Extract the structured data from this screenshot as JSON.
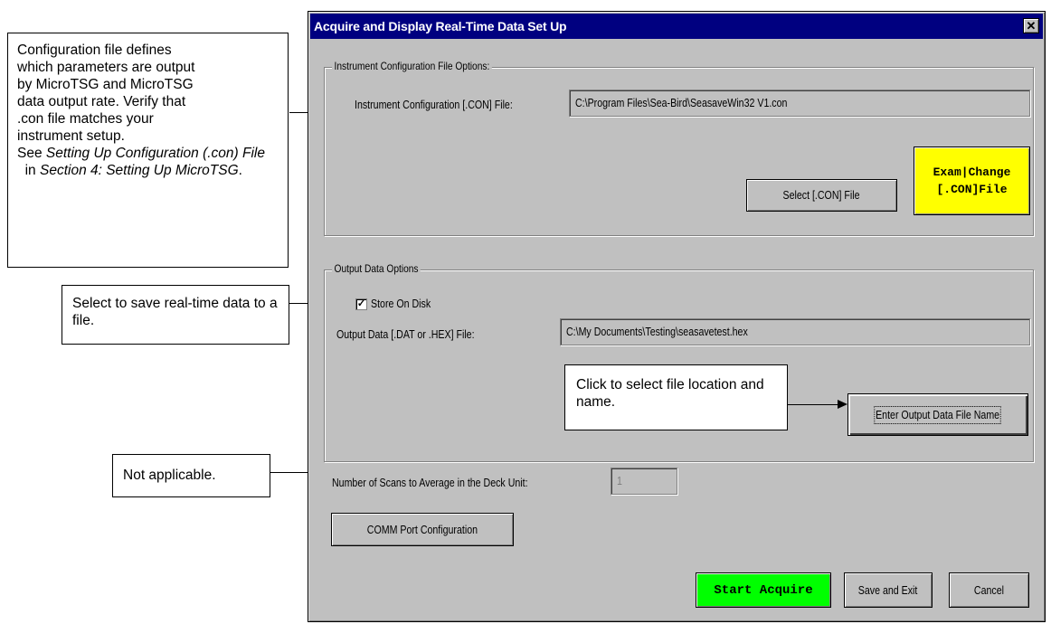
{
  "dialog": {
    "title": "Acquire and Display Real-Time Data Set Up",
    "close_glyph": "✕"
  },
  "instrument_group": {
    "label": "Instrument Configuration File Options:",
    "con_file_label": "Instrument Configuration [.CON] File:",
    "con_file_value": "C:\\Program Files\\Sea-Bird\\SeasaveWin32 V1.con",
    "select_con_button": "Select [.CON] File",
    "exam_change_line1": "Exam|Change",
    "exam_change_line2": "[.CON]File"
  },
  "output_group": {
    "label": "Output Data Options",
    "store_on_disk_label": "Store On Disk",
    "store_on_disk_checked": true,
    "check_glyph": "✓",
    "output_file_label": "Output Data [.DAT or .HEX] File:",
    "output_file_value": "C:\\My Documents\\Testing\\seasavetest.hex",
    "enter_output_button": "Enter Output Data File Name"
  },
  "scans": {
    "label": "Number of Scans to Average in the Deck Unit:",
    "value": "1"
  },
  "buttons": {
    "comm_port": "COMM Port Configuration",
    "start_acquire": "Start Acquire",
    "save_exit": "Save and Exit",
    "cancel": "Cancel"
  },
  "callouts": {
    "config": {
      "line1": "Configuration file defines",
      "line2": "which parameters are output",
      "line3": "by MicroTSG and MicroTSG",
      "line4": "data output rate. Verify that",
      "line5": ".con file matches your",
      "line6": "instrument setup.",
      "see": "See ",
      "ref1": "Setting Up Configuration (.con) File",
      "in": "  in ",
      "ref2": "Section 4: Setting Up MicroTSG",
      "end": "."
    },
    "store": "Select to save real-time data to a file.",
    "click_select": "Click to select file location and name.",
    "not_applicable": "Not applicable."
  },
  "colors": {
    "titlebar": "#000080",
    "exam_change_bg": "#ffff00",
    "start_acquire_bg": "#00ff00",
    "dialog_bg": "#c0c0c0"
  }
}
